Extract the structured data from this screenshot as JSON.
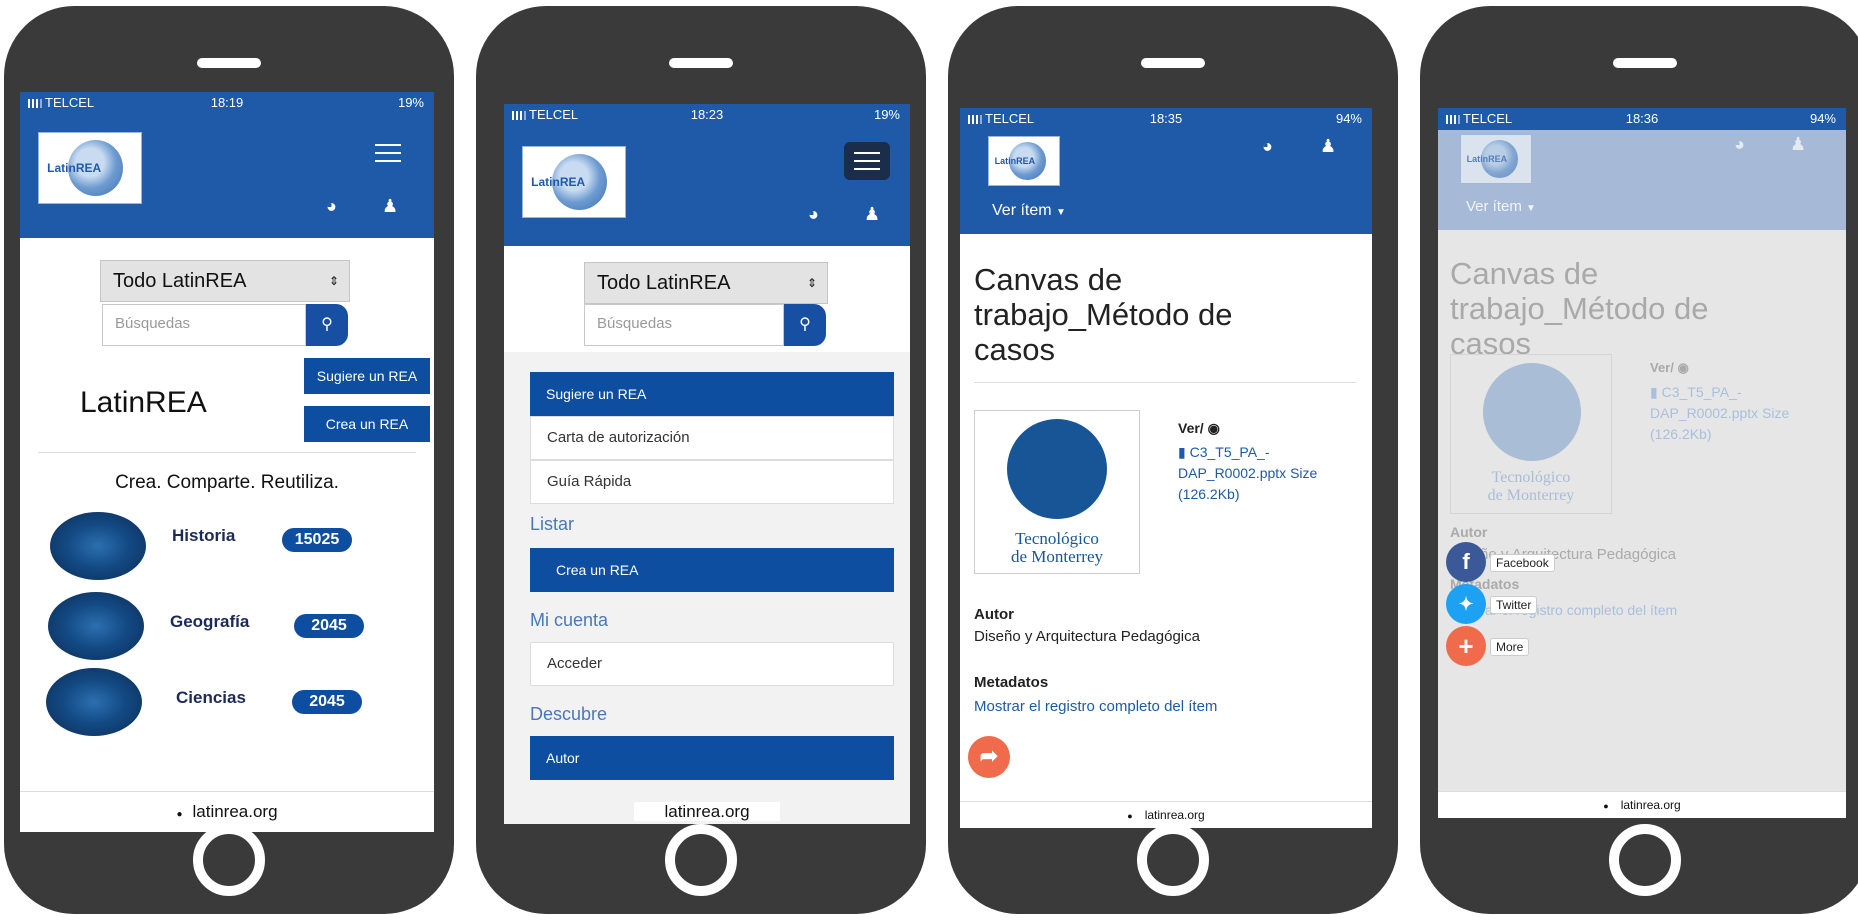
{
  "p1": {
    "status": {
      "carrier": "TELCEL",
      "time": "18:19",
      "battery": "19%"
    },
    "logo_text": "LatinREA",
    "select_value": "Todo LatinREA",
    "search_placeholder": "Búsquedas",
    "suggest_btn": "Sugiere un REA",
    "create_btn": "Crea  un REA",
    "site_title": "LatinREA",
    "tagline": "Crea. Comparte. Reutiliza.",
    "subjects": [
      {
        "name": "Historia",
        "count": "15025"
      },
      {
        "name": "Geografía",
        "count": "2045"
      },
      {
        "name": "Ciencias",
        "count": "2045"
      }
    ],
    "url": "latinrea.org"
  },
  "p2": {
    "status": {
      "carrier": "TELCEL",
      "time": "18:23",
      "battery": "19%"
    },
    "logo_text": "LatinREA",
    "select_value": "Todo LatinREA",
    "search_placeholder": "Búsquedas",
    "suggest_btn": "Sugiere un REA",
    "items": [
      "Carta de autorización",
      "Guía Rápida"
    ],
    "section_listar": "Listar",
    "create_btn": "Crea  un REA",
    "section_cuenta": "Mi cuenta",
    "acceder": "Acceder",
    "section_descubre": "Descubre",
    "autor": "Autor",
    "url": "latinrea.org"
  },
  "p3": {
    "status": {
      "carrier": "TELCEL",
      "time": "18:35",
      "battery": "94%"
    },
    "logo_text": "LatinREA",
    "ver_item": "Ver ítem",
    "title": "Canvas de trabajo_Método de casos",
    "tec_line1": "Tecnológico",
    "tec_line2": "de Monterrey",
    "ver_label": "Ver/",
    "file_link": "C3_T5_PA_-DAP_R0002.pptx Size (126.2Kb)",
    "autor_label": "Autor",
    "autor_value": "Diseño y Arquitectura Pedagógica",
    "metadatos_label": "Metadatos",
    "metadatos_link": "Mostrar el registro completo del ítem",
    "url": "latinrea.org"
  },
  "p4": {
    "status": {
      "carrier": "TELCEL",
      "time": "18:36",
      "battery": "94%"
    },
    "logo_text": "LatinREA",
    "ver_item": "Ver ítem",
    "title": "Canvas de trabajo_Método de casos",
    "tec_line1": "Tecnológico",
    "tec_line2": "de Monterrey",
    "ver_label": "Ver/",
    "file_link": "C3_T5_PA_-DAP_R0002.pptx Size (126.2Kb)",
    "autor_label": "Autor",
    "autor_value": "Diseño y Arquitectura Pedagógica",
    "metadatos_label": "Metadatos",
    "metadatos_link": "Mostrar el registro completo del ítem",
    "share": {
      "facebook": "Facebook",
      "twitter": "Twitter",
      "more": "More"
    },
    "url": "latinrea.org"
  },
  "colors": {
    "brand_blue": "#1e5aa8",
    "button_blue": "#0d4ea0",
    "share_orange": "#ef6b4b",
    "facebook": "#3b5998",
    "twitter": "#1da1f2"
  }
}
